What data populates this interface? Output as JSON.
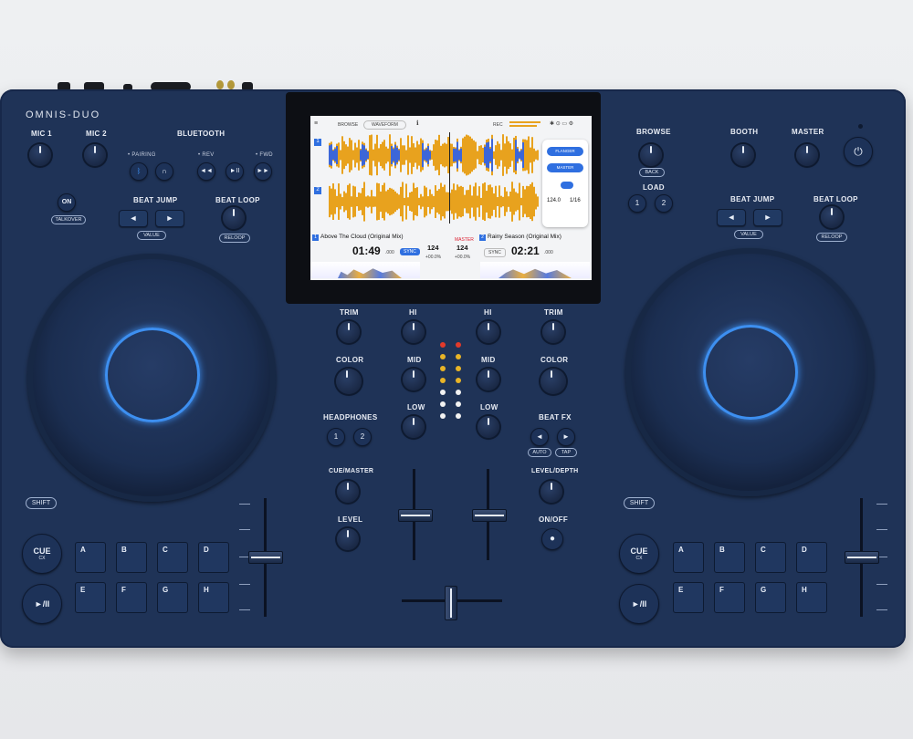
{
  "brand": "OMNIS-DUO",
  "left": {
    "mic1": "MIC 1",
    "mic2": "MIC 2",
    "bluetooth": "BLUETOOTH",
    "pairing": "• PAIRING",
    "rev": "• REV",
    "fwd": "• FWD",
    "on": "ON",
    "talkover": "TALKOVER",
    "beat_jump": "BEAT JUMP",
    "value": "VALUE",
    "beat_loop": "BEAT LOOP",
    "reloop": "RELOOP",
    "shift": "SHIFT",
    "cue": "CUE",
    "cue_sub": "CX",
    "play": "►/II",
    "pads": [
      "A",
      "B",
      "C",
      "D",
      "E",
      "F",
      "G",
      "H"
    ]
  },
  "right": {
    "browse": "BROWSE",
    "back": "BACK",
    "load": "LOAD",
    "load1": "1",
    "load2": "2",
    "booth": "BOOTH",
    "master": "MASTER",
    "beat_jump": "BEAT JUMP",
    "value": "VALUE",
    "beat_loop": "BEAT LOOP",
    "reloop": "RELOOP",
    "shift": "SHIFT",
    "cue": "CUE",
    "cue_sub": "CX",
    "play": "►/II",
    "pads": [
      "A",
      "B",
      "C",
      "D",
      "E",
      "F",
      "G",
      "H"
    ]
  },
  "mixer": {
    "trim": "TRIM",
    "hi": "HI",
    "mid": "MID",
    "low": "LOW",
    "color": "COLOR",
    "headphones": "HEADPHONES",
    "hp1": "1",
    "hp2": "2",
    "beat_fx": "BEAT FX",
    "auto": "AUTO",
    "tap": "TAP",
    "cue_master": "CUE/MASTER",
    "level": "LEVEL",
    "level_depth": "LEVEL/DEPTH",
    "on_off": "ON/OFF"
  },
  "screen": {
    "browse": "BROWSE",
    "waveform": "WAVEFORM",
    "rec": "REC",
    "fx_flanger": "FLANGER",
    "fx_master": "MASTER",
    "fx_ch": "CH",
    "deck1": {
      "num": "1",
      "title": "Above The Cloud (Original Mix)",
      "time": "01:49",
      "time_ms": ".000",
      "sync": "SYNC",
      "bpm": "124",
      "bpm_dec": ".0",
      "pitch": "+00.0%",
      "master": "MASTER"
    },
    "deck2": {
      "num": "2",
      "title": "Rainy Season (Original Mix)",
      "time": "02:21",
      "time_ms": ".000",
      "sync": "SYNC",
      "bpm": "124",
      "bpm_dec": ".0",
      "pitch": "+00.0%"
    },
    "fx_bpm": "124.0",
    "fx_beat": "1/16",
    "colors": {
      "wave1": "#e8a21e",
      "wave2": "#3c66d8",
      "accent": "#2f6fe0"
    }
  },
  "colors": {
    "body": "#1f3357",
    "ring": "#3d8ff0",
    "led_red": "#e23a2a",
    "led_yellow": "#e8b427",
    "led_white": "#f2f2f2"
  }
}
